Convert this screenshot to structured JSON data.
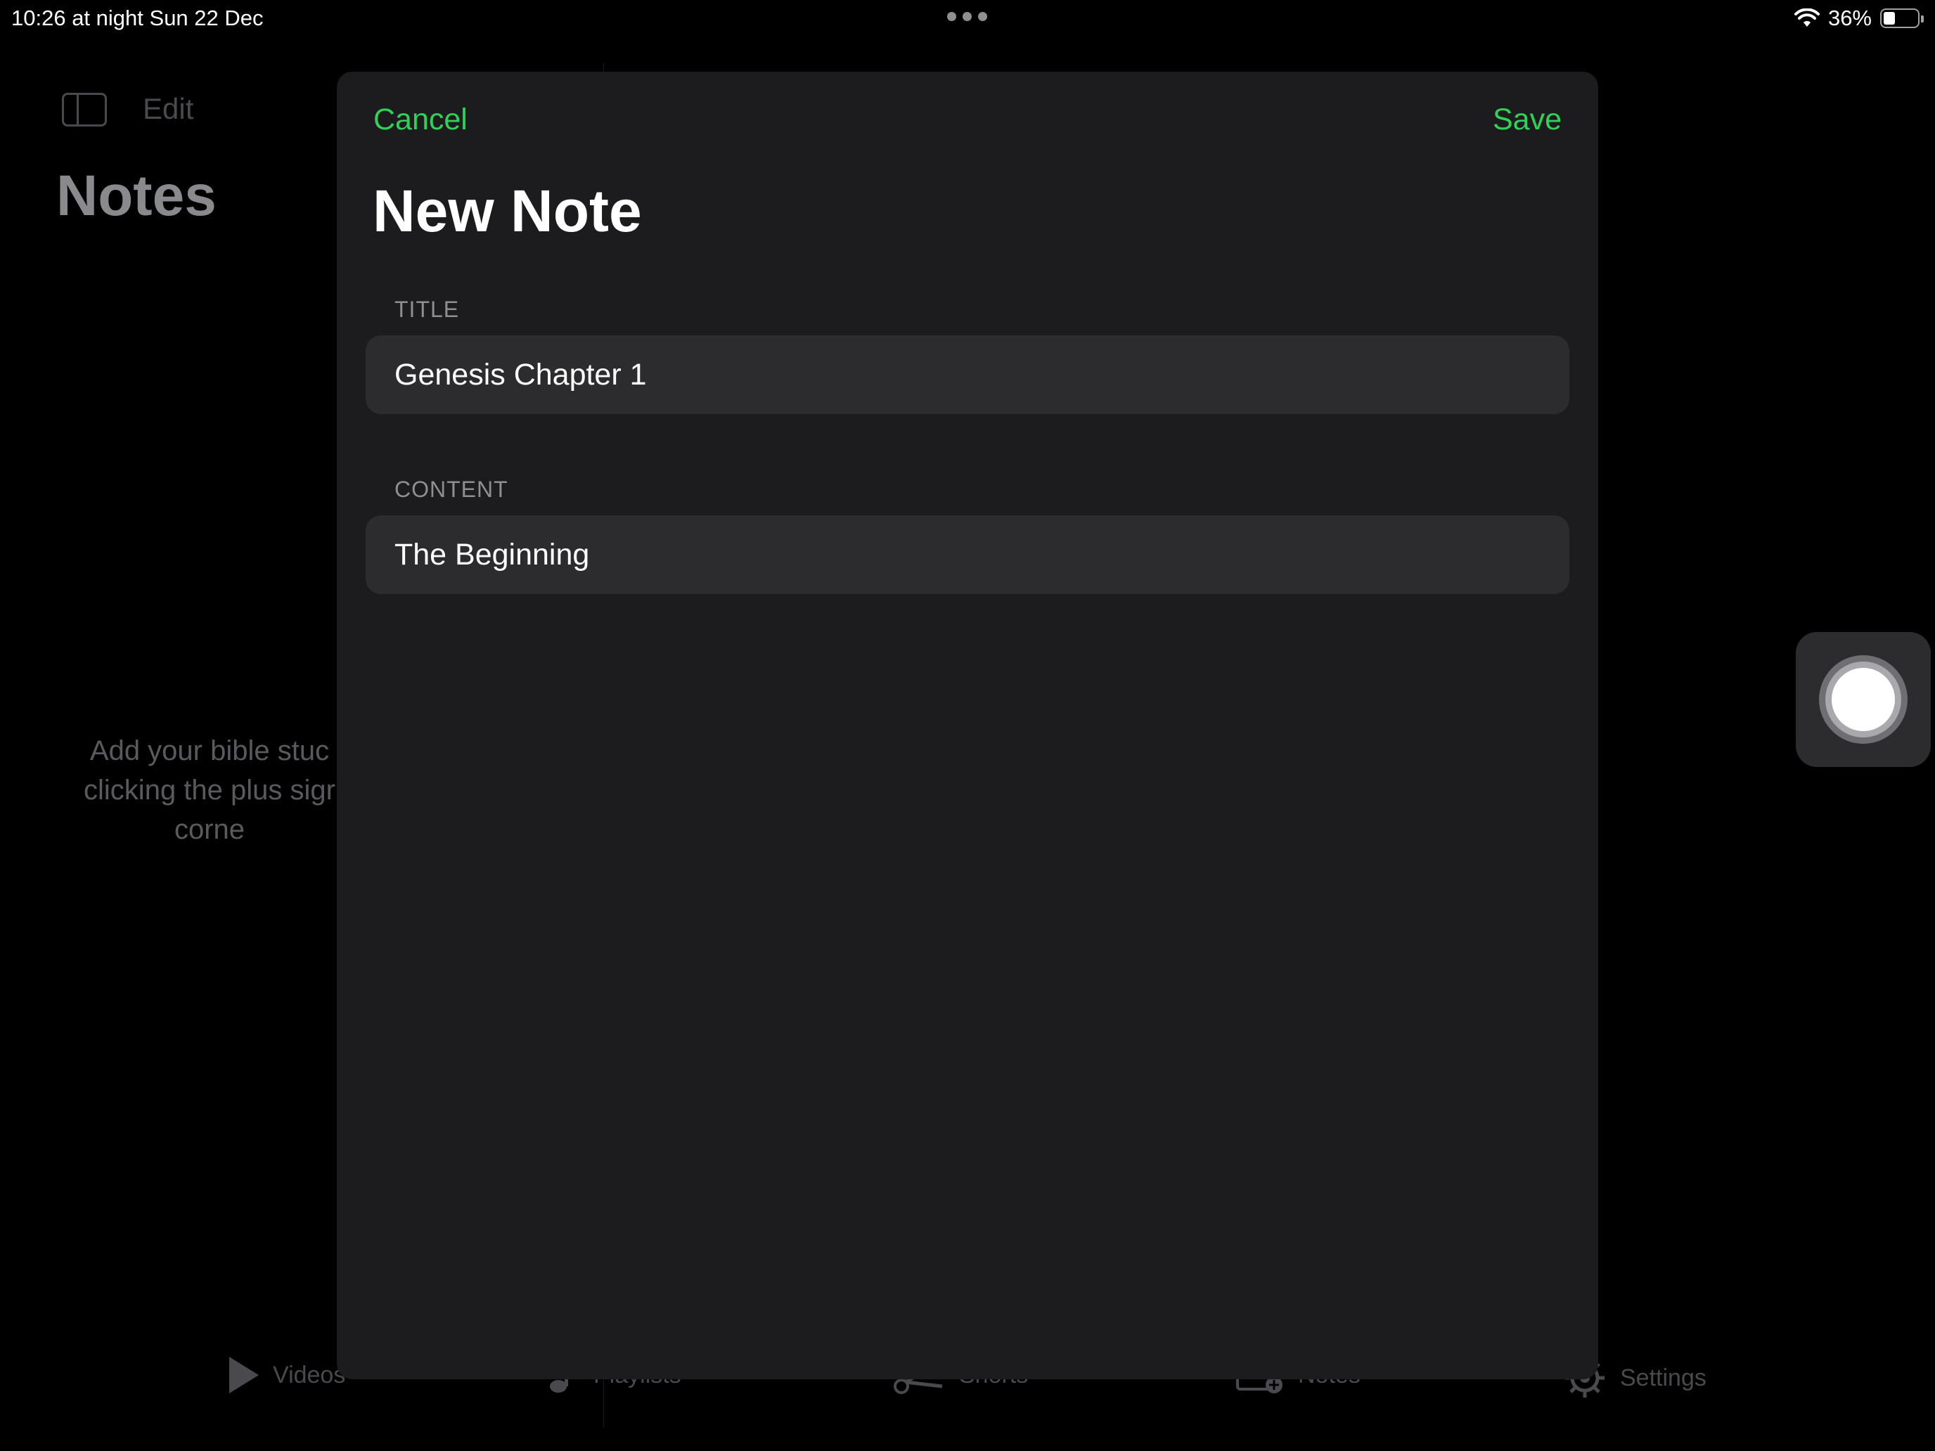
{
  "status_bar": {
    "time": "10:26 at night",
    "date": "Sun 22 Dec",
    "battery_percent": "36%",
    "battery_level": 0.36,
    "icons": [
      "multitasking-dots-icon",
      "wifi-icon",
      "battery-icon"
    ]
  },
  "background_app": {
    "edit_label": "Edit",
    "title": "Notes",
    "empty_hint": "Add your bible stuc clicking the plus sigr corne",
    "tabs": [
      {
        "label": "Videos",
        "icon": "play-icon"
      },
      {
        "label": "Playlists",
        "icon": "music-note-icon"
      },
      {
        "label": "Shorts",
        "icon": "scissors-icon"
      },
      {
        "label": "Notes",
        "icon": "add-note-icon"
      },
      {
        "label": "Settings",
        "icon": "gear-icon"
      }
    ]
  },
  "sheet": {
    "cancel_label": "Cancel",
    "save_label": "Save",
    "title": "New Note",
    "title_section_header": "TITLE",
    "title_value": "Genesis Chapter 1",
    "content_section_header": "CONTENT",
    "content_value": "The Beginning"
  },
  "colors": {
    "accent": "#30d158",
    "sheet_background": "#1c1c1e",
    "field_background": "#2c2c2e",
    "screen_background": "#000000"
  }
}
